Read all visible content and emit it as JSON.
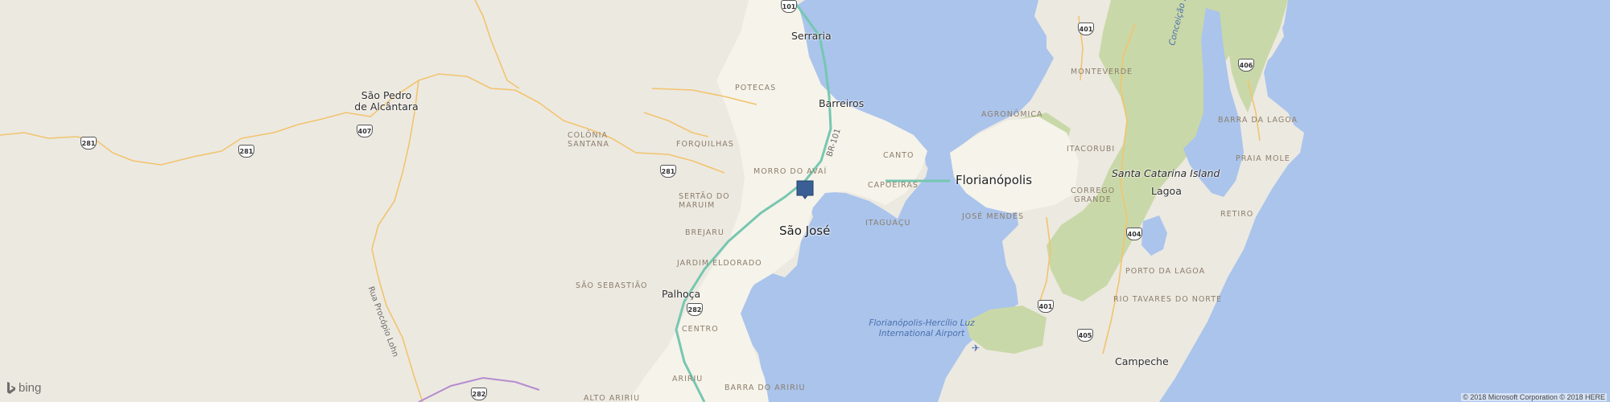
{
  "map": {
    "provider": "bing",
    "copyright": "© 2018 Microsoft Corporation © 2018 HERE",
    "colors": {
      "water": "#aac4ec",
      "land": "#ece9e1",
      "park": "#c9d8a8",
      "urban": "#f6f3ea",
      "highway": "#78c8b2",
      "road_major": "#f4c977",
      "pin": "#3a5f94"
    },
    "cities": [
      {
        "name": "Florianópolis"
      },
      {
        "name": "São José"
      },
      {
        "name": "Palhoça"
      },
      {
        "name": "Serraria"
      },
      {
        "name": "Barreiros"
      },
      {
        "name": "Lagoa"
      },
      {
        "name": "Campeche"
      },
      {
        "name": "Santa Catarina Island"
      },
      {
        "name": "São Pedro de Alcântara"
      }
    ],
    "neighborhoods": [
      "POTECAS",
      "COLÔNIA SANTANA",
      "FORQUILHAS",
      "MORRO DO AVAÍ",
      "SERTÃO DO MARUIM",
      "BREJARU",
      "JARDIM ELDORADO",
      "SÃO SEBASTIÃO",
      "CENTRO",
      "ARIRIU",
      "ALTO ARIRIU",
      "BARRA DO ARIRIU",
      "CANTO",
      "CAPOEIRAS",
      "ITAGUAÇU",
      "AGRONÔMICA",
      "MONTEVERDE",
      "ITACORUBI",
      "CORREGO GRANDE",
      "JOSÉ MENDES",
      "BARRA DA LAGOA",
      "PRAIA MOLE",
      "RETIRO",
      "PORTO DA LAGOA",
      "RIO TAVARES DO NORTE"
    ],
    "water_labels": [
      "Conceição Lagoon",
      "Florianópolis-Hercílio Luz International Airport"
    ],
    "road_labels": [
      "BR-101",
      "Rua Procópio Lohn"
    ],
    "shields": [
      "101",
      "281",
      "407",
      "281",
      "281",
      "282",
      "282",
      "401",
      "406",
      "404",
      "401",
      "405"
    ],
    "pin": {
      "label": "",
      "icon": "map-pin-icon"
    }
  },
  "branding": {
    "logo_text": "bing",
    "logo_icon": "bing-logo-icon"
  }
}
